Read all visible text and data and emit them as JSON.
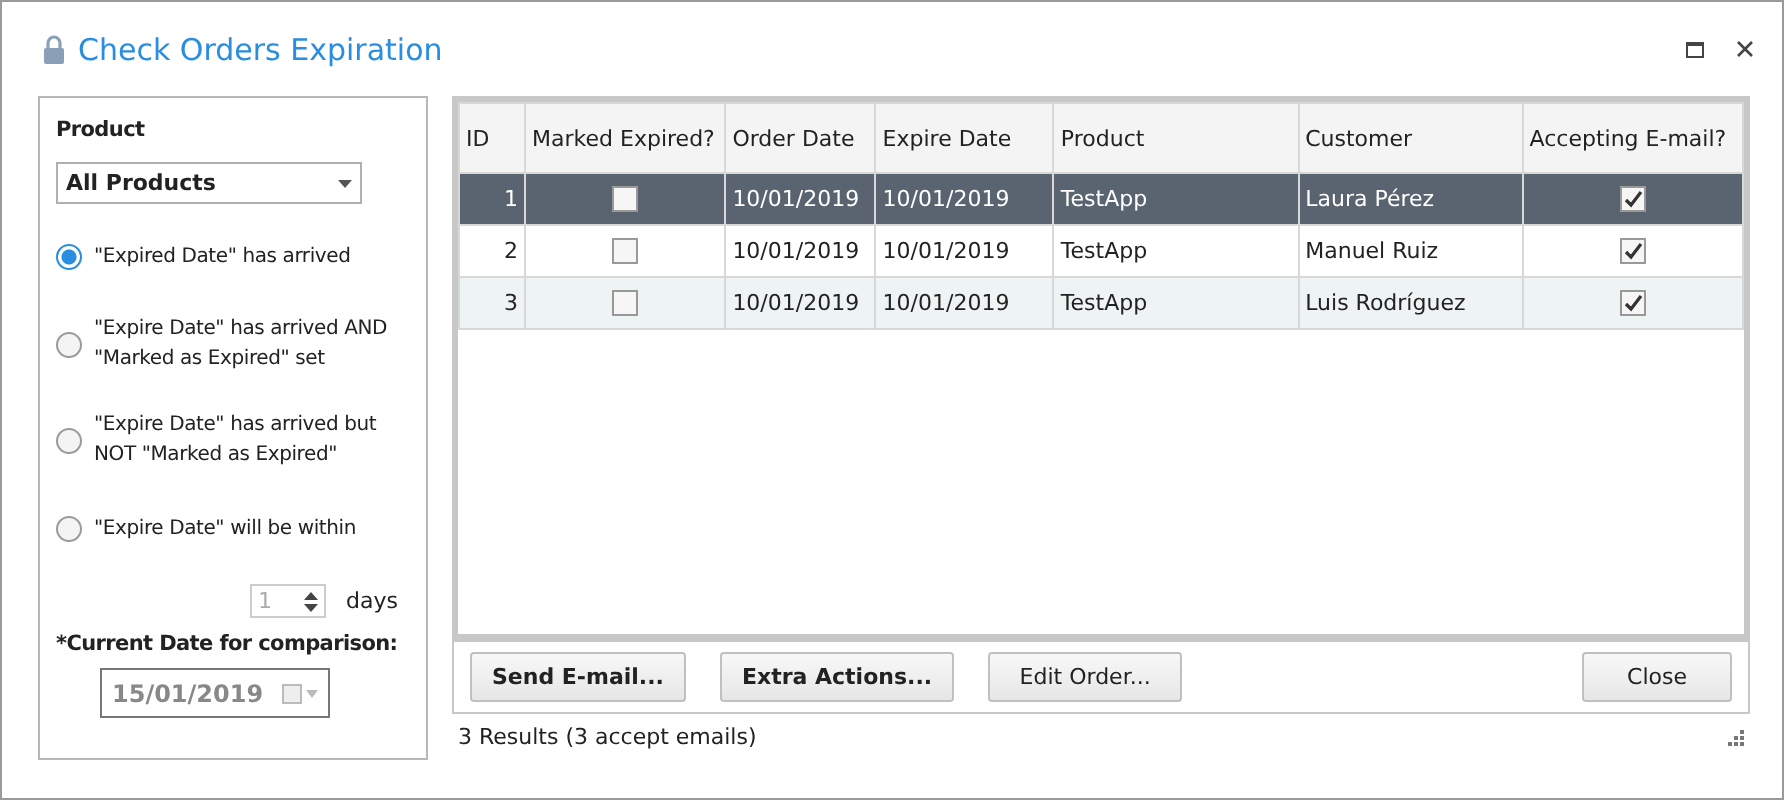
{
  "window": {
    "title": "Check Orders Expiration"
  },
  "filter": {
    "product_label": "Product",
    "product_value": "All Products",
    "options": [
      {
        "label": "\"Expired Date\" has arrived",
        "selected": true
      },
      {
        "label": "\"Expire Date\" has arrived AND \"Marked as Expired\" set",
        "selected": false
      },
      {
        "label": "\"Expire Date\" has arrived but NOT \"Marked as Expired\"",
        "selected": false
      },
      {
        "label": "\"Expire Date\" will be within",
        "selected": false
      }
    ],
    "days_value": "1",
    "days_label": "days",
    "date_label": "*Current Date for comparison:",
    "date_value": "15/01/2019"
  },
  "table": {
    "columns": [
      "ID",
      "Marked Expired?",
      "Order Date",
      "Expire Date",
      "Product",
      "Customer",
      "Accepting E-mail?"
    ],
    "rows": [
      {
        "id": "1",
        "marked_expired": false,
        "order_date": "10/01/2019",
        "expire_date": "10/01/2019",
        "product": "TestApp",
        "customer": "Laura Pérez",
        "accepting_email": true,
        "selected": true
      },
      {
        "id": "2",
        "marked_expired": false,
        "order_date": "10/01/2019",
        "expire_date": "10/01/2019",
        "product": "TestApp",
        "customer": "Manuel Ruiz",
        "accepting_email": true,
        "selected": false
      },
      {
        "id": "3",
        "marked_expired": false,
        "order_date": "10/01/2019",
        "expire_date": "10/01/2019",
        "product": "TestApp",
        "customer": "Luis Rodríguez",
        "accepting_email": true,
        "selected": false
      }
    ]
  },
  "buttons": [
    {
      "label": "Send E-mail...",
      "kind": "bold"
    },
    {
      "label": "Extra Actions...",
      "kind": "bold"
    },
    {
      "label": "Edit Order...",
      "kind": "normal"
    }
  ],
  "close_button": "Close",
  "status_bar": "3 Results (3 accept emails)"
}
